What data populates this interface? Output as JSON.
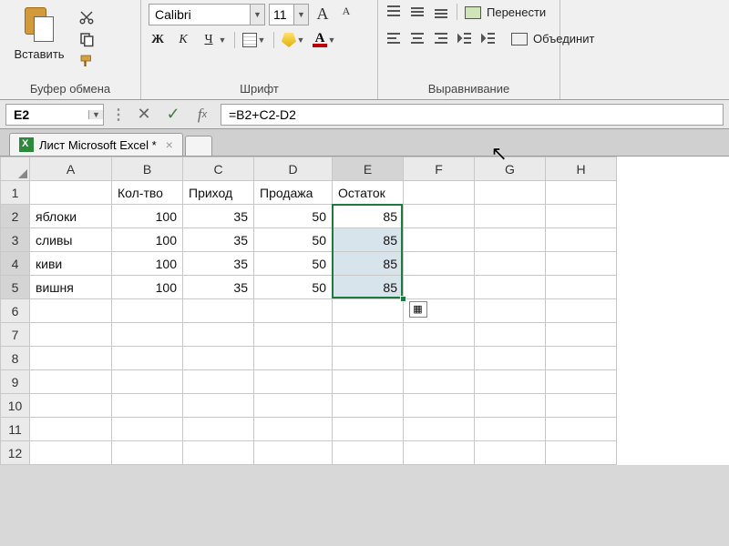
{
  "ribbon": {
    "clipboard": {
      "paste": "Вставить",
      "group_label": "Буфер обмена"
    },
    "font": {
      "name": "Calibri",
      "size": "11",
      "group_label": "Шрифт",
      "bold": "Ж",
      "italic": "К",
      "underline": "Ч"
    },
    "align": {
      "wrap": "Перенести",
      "merge": "Объединит",
      "group_label": "Выравнивание"
    }
  },
  "formula_bar": {
    "cell_ref": "E2",
    "formula": "=B2+C2-D2"
  },
  "tab": {
    "title": "Лист Microsoft Excel *"
  },
  "columns": [
    "A",
    "B",
    "C",
    "D",
    "E",
    "F",
    "G",
    "H"
  ],
  "rows": [
    1,
    2,
    3,
    4,
    5,
    6,
    7,
    8,
    9,
    10,
    11,
    12
  ],
  "headers": {
    "B": "Кол-тво",
    "C": "Приход",
    "D": "Продажа",
    "E": "Остаток"
  },
  "data": [
    {
      "A": "яблоки",
      "B": 100,
      "C": 35,
      "D": 50,
      "E": 85
    },
    {
      "A": "сливы",
      "B": 100,
      "C": 35,
      "D": 50,
      "E": 85
    },
    {
      "A": "киви",
      "B": 100,
      "C": 35,
      "D": 50,
      "E": 85
    },
    {
      "A": "вишня",
      "B": 100,
      "C": 35,
      "D": 50,
      "E": 85
    }
  ],
  "selection": {
    "col": "E",
    "rows": [
      2,
      3,
      4,
      5
    ],
    "active": "E2"
  }
}
